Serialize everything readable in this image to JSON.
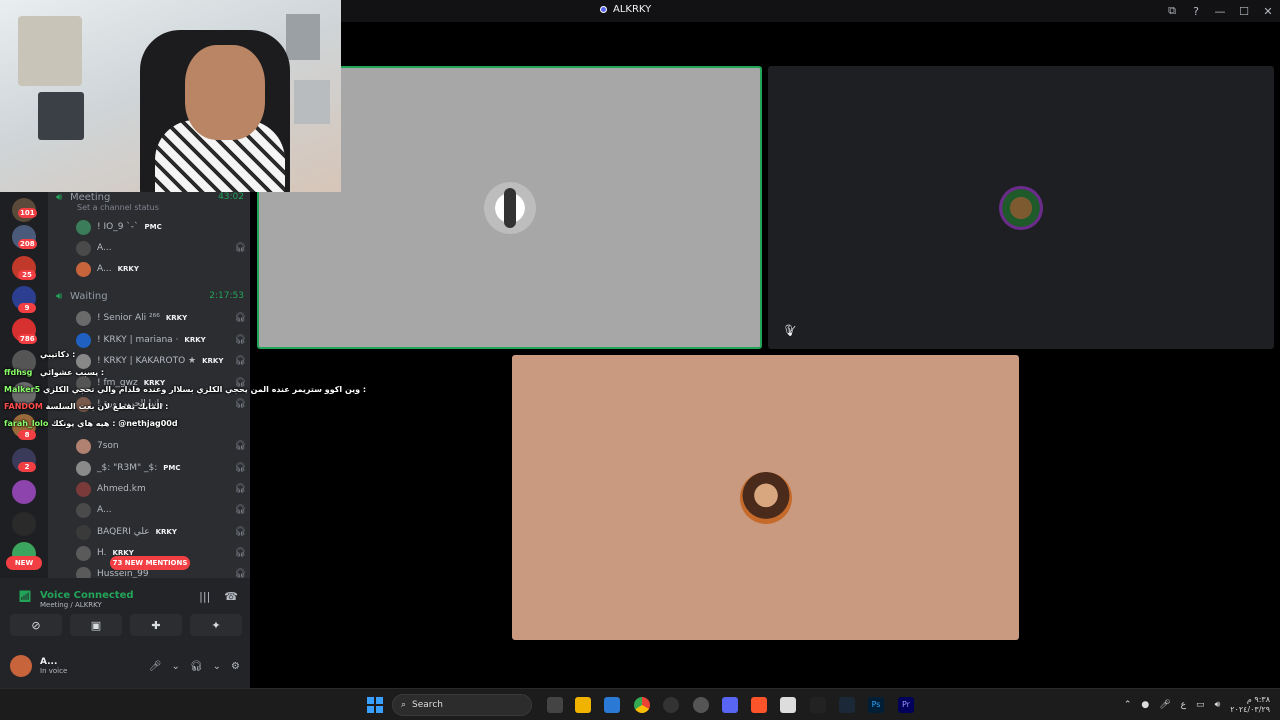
{
  "window": {
    "title": "ALKRKY",
    "controls": [
      "⧉",
      "?",
      "—",
      "☐",
      "✕"
    ]
  },
  "guilds": [
    {
      "badge": "101",
      "color": "#5a4a3a"
    },
    {
      "badge": "208",
      "color": "#4a5a7a"
    },
    {
      "badge": "25",
      "color": "#c0392b"
    },
    {
      "badge": "9",
      "color": "#2c3e8f"
    },
    {
      "badge": "786",
      "color": "#d63031"
    },
    {
      "badge": "",
      "color": "#555"
    },
    {
      "badge": "",
      "color": "#6a6a6a"
    },
    {
      "badge": "8",
      "color": "#9a6a3a"
    },
    {
      "badge": "2",
      "color": "#3a3a5a"
    },
    {
      "badge": "",
      "color": "#8e44ad"
    },
    {
      "badge": "",
      "color": "#2a2a2a"
    },
    {
      "badge": "",
      "color": "#3ba55d"
    }
  ],
  "guild_new_label": "NEW",
  "channels": {
    "meeting": {
      "name": "Meeting",
      "time": "43:02",
      "status_placeholder": "Set a channel status"
    },
    "meeting_users": [
      {
        "name": "! IO_9 `-`",
        "tag": "PMC",
        "color": "#3b7d5a"
      },
      {
        "name": "A...",
        "tag": "",
        "color": "#4a4a4a"
      },
      {
        "name": "A...",
        "tag": "KRKY",
        "color": "#c8643c"
      }
    ],
    "waiting": {
      "name": "Waiting",
      "time": "2:17:53"
    },
    "waiting_users": [
      {
        "name": "! Senior Ali ²⁶⁶",
        "tag": "KRKY",
        "color": "#6a6a6a"
      },
      {
        "name": "! KRKY | mariana ·",
        "tag": "KRKY",
        "color": "#2060c0"
      },
      {
        "name": "! KRKY | KAKAROTO ★",
        "tag": "KRKY",
        "color": "#888"
      },
      {
        "name": "! fm_gwz",
        "tag": "KRKY",
        "color": "#555"
      },
      {
        "name": "! رانيا الحربي ورة",
        "tag": "",
        "color": "#7a5a4a"
      },
      {
        "name": "7son",
        "tag": "",
        "color": "#b08070"
      },
      {
        "name": "_$: \"R3M\" _$:",
        "tag": "PMC",
        "color": "#8a8a8a"
      },
      {
        "name": "Ahmed.km",
        "tag": "",
        "color": "#7a3a3a"
      },
      {
        "name": "A...",
        "tag": "",
        "color": "#4a4a4a"
      },
      {
        "name": "BAQERI ﻋﻠﻲ",
        "tag": "KRKY",
        "color": "#3a3a3a"
      },
      {
        "name": "H.",
        "tag": "KRKY",
        "color": "#5a5a5a"
      },
      {
        "name": "Hussein_99",
        "tag": "",
        "color": "#5a5a5a"
      }
    ],
    "new_mentions": "73 NEW MENTIONS"
  },
  "chat_overlay": [
    {
      "name": "",
      "text": "دكاتيبي :",
      "red": false
    },
    {
      "name": "",
      "text": "يسبب عشوائي :",
      "red": false
    },
    {
      "name": "ffdhsg",
      "text": "",
      "red": false
    },
    {
      "name": "Malker5",
      "text": "وين اكوو ستريمر عنده المن يحجي الكلزي بسلاار وعنده فلدام والي تحجي الكلزي :",
      "red": false
    },
    {
      "name": "FANDOM",
      "text": "المايك يقطع لان بعت السلسة :",
      "red": true
    },
    {
      "name": "farah_lolo",
      "text": "هيه هاي يونكك : @nethjag00d",
      "red": false
    }
  ],
  "voice_panel": {
    "status": "Voice Connected",
    "location": "Meeting / ALKRKY",
    "user_name": "A...",
    "user_status": "In voice"
  },
  "tiles": [
    {
      "id": "tile-1",
      "speaking": true
    },
    {
      "id": "tile-2",
      "muted": true
    },
    {
      "id": "tile-3",
      "speaking": false
    }
  ],
  "taskbar": {
    "search_placeholder": "Search",
    "clock_time": "٩:٣٨ م",
    "clock_date": "٢٠٢٤/٠٣/٢٩",
    "lang": "ع"
  },
  "colors": {
    "accent_green": "#23a559",
    "mention_red": "#f23f43",
    "blurple": "#5865f2"
  }
}
